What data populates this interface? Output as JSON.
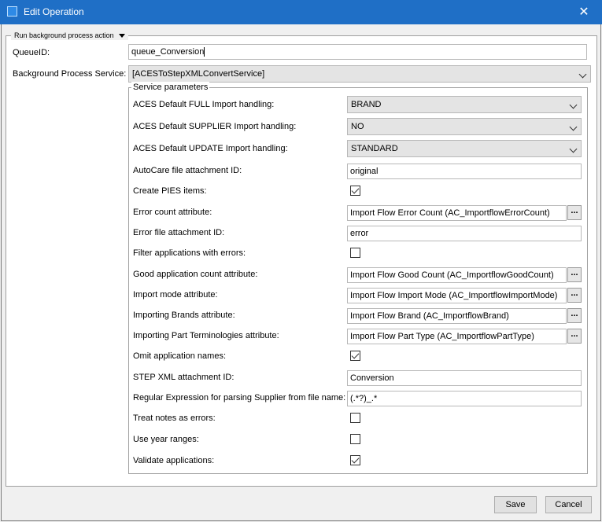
{
  "window": {
    "title": "Edit Operation"
  },
  "group": {
    "legend": "Run background process action"
  },
  "queue": {
    "label": "QueueID:",
    "value": "queue_Conversion"
  },
  "service": {
    "label": "Background Process Service:",
    "value": "[ACESToStepXMLConvertService]"
  },
  "params": {
    "legend": "Service parameters",
    "rows": [
      {
        "label": "ACES Default FULL Import handling:",
        "type": "select",
        "value": "BRAND"
      },
      {
        "label": "ACES Default SUPPLIER Import handling:",
        "type": "select",
        "value": "NO"
      },
      {
        "label": "ACES Default UPDATE Import handling:",
        "type": "select",
        "value": "STANDARD"
      },
      {
        "label": "AutoCare file attachment ID:",
        "type": "text",
        "value": "original"
      },
      {
        "label": "Create PIES items:",
        "type": "checkbox",
        "checked": true
      },
      {
        "label": "Error count attribute:",
        "type": "lookup",
        "value": "Import Flow Error Count (AC_ImportflowErrorCount)"
      },
      {
        "label": "Error file attachment ID:",
        "type": "text",
        "value": "error"
      },
      {
        "label": "Filter applications with errors:",
        "type": "checkbox",
        "checked": false
      },
      {
        "label": "Good application count attribute:",
        "type": "lookup",
        "value": "Import Flow Good Count (AC_ImportflowGoodCount)"
      },
      {
        "label": "Import mode attribute:",
        "type": "lookup",
        "value": "Import Flow Import Mode (AC_ImportflowImportMode)"
      },
      {
        "label": "Importing Brands attribute:",
        "type": "lookup",
        "value": "Import Flow Brand (AC_ImportflowBrand)"
      },
      {
        "label": "Importing Part Terminologies attribute:",
        "type": "lookup",
        "value": "Import Flow Part Type (AC_ImportflowPartType)"
      },
      {
        "label": "Omit application names:",
        "type": "checkbox",
        "checked": true
      },
      {
        "label": "STEP XML attachment ID:",
        "type": "text",
        "value": "Conversion"
      },
      {
        "label": "Regular Expression for parsing Supplier from file name:",
        "type": "text",
        "value": "(.*?)_.*"
      },
      {
        "label": "Treat notes as errors:",
        "type": "checkbox",
        "checked": false
      },
      {
        "label": "Use year ranges:",
        "type": "checkbox",
        "checked": false
      },
      {
        "label": "Validate applications:",
        "type": "checkbox",
        "checked": true
      }
    ],
    "lookup_button": "..."
  },
  "footer": {
    "save_label": "Save",
    "cancel_label": "Cancel"
  },
  "icons": {
    "window": "window-icon",
    "close": "close-icon",
    "dropdown": "chevron-down-icon",
    "check": "checkmark-icon",
    "collapse": "caret-down-icon"
  },
  "colors": {
    "titlebar": "#1f6fc6",
    "background": "#f0f0f0"
  }
}
